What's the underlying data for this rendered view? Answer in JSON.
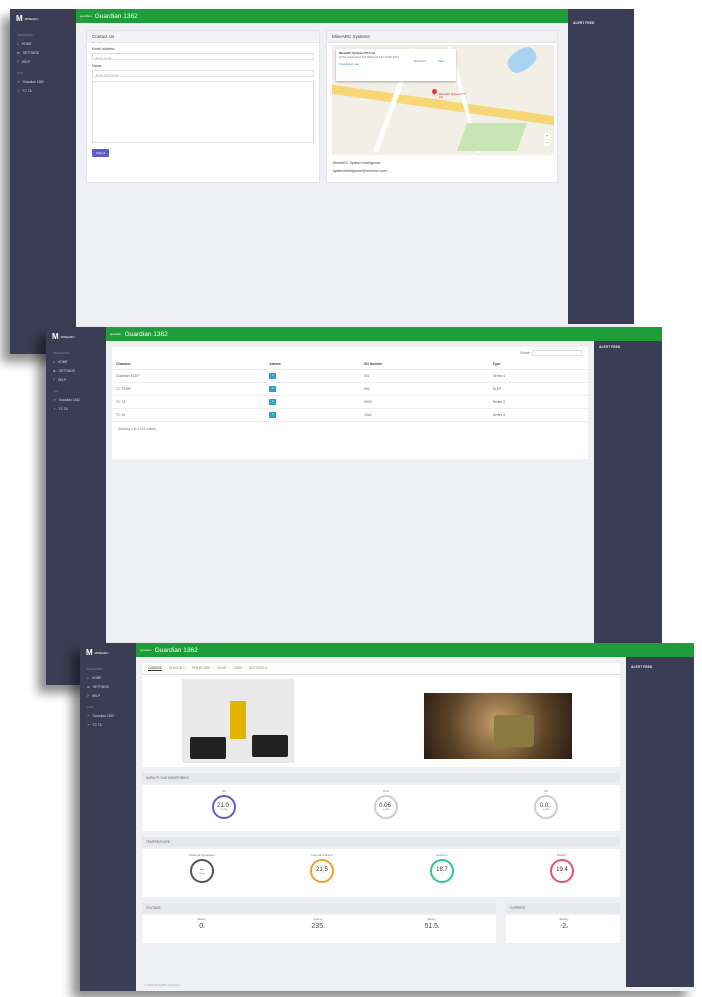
{
  "app": {
    "logo_mark": "M",
    "logo_text": "MINEARC",
    "title": "Guardian 1362",
    "crumb": "guardian",
    "alert_label": "ALERT FEED",
    "sidebar_group1": "NAVIGATION",
    "sidebar_group2": "UNIT",
    "nav": [
      "HOME",
      "SETTINGS",
      "HELP"
    ],
    "units": [
      "Guardian 1362",
      "TC TA"
    ]
  },
  "contact": {
    "heading": "Contact Us",
    "email_label": "Email address",
    "email_placeholder": "Enter email",
    "name_label": "Name",
    "name_placeholder": "Enter your name",
    "submit": "Submit"
  },
  "map": {
    "heading": "MineARC Systems",
    "company": "MineARC Systems PTY Ltd",
    "address": "42-51 Chelmsford Rd, Wetherill Park NSW 2164",
    "link": "View larger map",
    "directions": "Directions",
    "save": "Save",
    "place": "MineARC Systems PTY Ltd",
    "line1": "MineARC System Intelligence",
    "line2": "systemintelligence@minearc.com"
  },
  "table": {
    "search_label": "Search:",
    "headers": [
      "Chamber",
      "Alarms",
      "SN Number",
      "Type"
    ],
    "rows": [
      [
        "Guardian ELEP",
        "1",
        "001",
        "Series 4"
      ],
      [
        "TC TEMP",
        "1",
        "002",
        "ELEP"
      ],
      [
        "TC TA",
        "1",
        "0005",
        "Series 3"
      ],
      [
        "TC 04",
        "1",
        "1362",
        "Series 4"
      ]
    ],
    "footer": "Showing 1 to 4 of 4 entries"
  },
  "dash": {
    "tabs": [
      "CAMERA",
      "SENSOR 2",
      "PAN BOARD",
      "ALMS",
      "CAMS",
      "BATTERIES"
    ],
    "sec_aura": "AURA FX GAS MONITORING",
    "sec_temp": "TEMPERATURE",
    "sec_voltage": "VOLTAGE",
    "sec_current": "CURRENT",
    "footer": "© 2019 MineARC Systems",
    "gauges": [
      {
        "label": "O2",
        "value": "21.0",
        "unit": "%",
        "sub": "NORM"
      },
      {
        "label": "CO2",
        "value": "0.06",
        "unit": "%",
        "sub": "NORM"
      },
      {
        "label": "CO",
        "value": "0.0",
        "unit": "ppm",
        "sub": "NORM"
      }
    ],
    "temps": [
      {
        "label": "External Apparatus",
        "value": "--",
        "sub": "Offline"
      },
      {
        "label": "Internal Ambient",
        "value": "21.5",
        "sub": "°C"
      },
      {
        "label": "External",
        "value": "18.7",
        "sub": "°C"
      },
      {
        "label": "Battery",
        "value": "19.4",
        "sub": "°C"
      }
    ],
    "volts": [
      {
        "label": "Battery",
        "value": "0",
        "unit": "v"
      },
      {
        "label": "Inverter",
        "value": "235",
        "unit": "v"
      },
      {
        "label": "Battery",
        "value": "51.5",
        "unit": "v"
      }
    ],
    "amps": [
      {
        "label": "Battery",
        "value": "-2",
        "unit": "A"
      }
    ]
  },
  "colors": {
    "header": "#1f9d3b",
    "sidebar": "#3b3d54",
    "o2": "#6a5acd",
    "co2": "#cccccc",
    "temp1": "#f0a030",
    "temp2": "#2ec4a0",
    "temp3": "#e8506a"
  }
}
